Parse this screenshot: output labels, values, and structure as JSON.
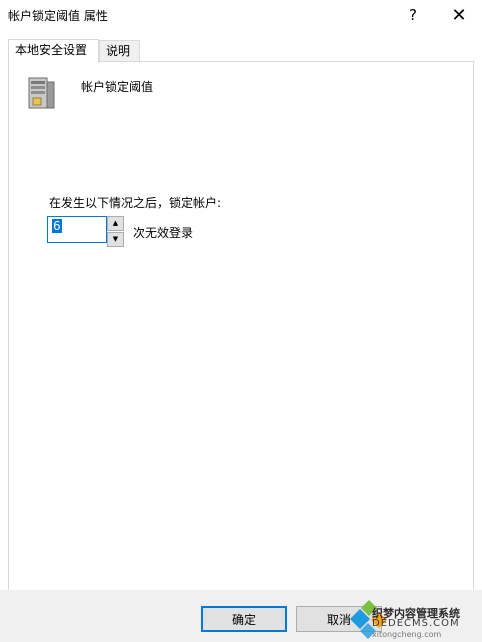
{
  "window": {
    "title": "帐户锁定阈值 属性",
    "help_glyph": "?",
    "close_glyph": "✕"
  },
  "tabs": [
    {
      "label": "本地安全设置",
      "active": true
    },
    {
      "label": "说明",
      "active": false
    }
  ],
  "policy": {
    "name": "帐户锁定阈值",
    "icon": "server-icon"
  },
  "setting": {
    "prompt": "在发生以下情况之后，锁定帐户:",
    "value": "6",
    "unit_label": "次无效登录"
  },
  "buttons": {
    "ok_label": "确定",
    "cancel_label": "取消"
  },
  "watermark": {
    "brand_text": "织梦内容管理系统",
    "url_text": "DEDECMS.COM",
    "sub_text": "xitongcheng.com"
  },
  "colors": {
    "accent": "#0078d7",
    "window_bg": "#ffffff",
    "footer_bg": "#f0f0f0"
  }
}
